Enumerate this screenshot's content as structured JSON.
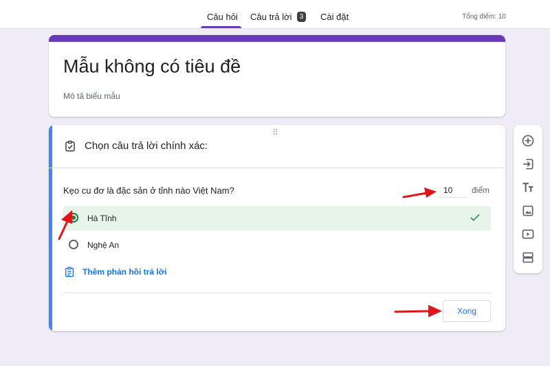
{
  "header": {
    "tabs": [
      {
        "label": "Câu hỏi",
        "active": true
      },
      {
        "label": "Câu trả lời",
        "badge": "3"
      },
      {
        "label": "Cài đặt"
      }
    ],
    "total_points": "Tổng điểm: 10"
  },
  "form": {
    "title": "Mẫu không có tiêu đề",
    "description_placeholder": "Mô tả biểu mẫu"
  },
  "question": {
    "answer_key_title": "Chọn câu trả lời chính xác:",
    "text": "Kẹo cu đơ là đặc sản ở tỉnh nào Việt Nam?",
    "points_value": "10",
    "points_label": "điểm",
    "options": [
      {
        "label": "Hà Tĩnh",
        "selected": true,
        "correct": true
      },
      {
        "label": "Nghệ An",
        "selected": false,
        "correct": false
      }
    ],
    "feedback_link": "Thêm phản hồi trả lời",
    "done_button": "Xong"
  },
  "toolbar": {
    "icons": [
      "add-question-icon",
      "import-questions-icon",
      "add-title-icon",
      "add-image-icon",
      "add-video-icon",
      "add-section-icon"
    ]
  },
  "colors": {
    "accent": "#673ab7",
    "focus_bar": "#4285f4",
    "correct_bg": "#e6f4ea",
    "correct_green": "#188038",
    "link_blue": "#1a73e8",
    "annotation_red": "#e0161b",
    "background": "#efebf7"
  }
}
